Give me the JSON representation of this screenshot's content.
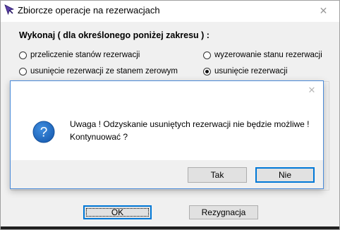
{
  "window": {
    "title": "Zbiorcze operacje na rezerwacjach",
    "close_glyph": "✕",
    "app_icon": "purple-cursor-icon"
  },
  "main": {
    "heading": "Wykonaj ( dla określonego poniżej zakresu ) :",
    "options": [
      {
        "label": "przeliczenie stanów rezerwacji",
        "checked": false
      },
      {
        "label": "wyzerowanie stanu rezerwacji",
        "checked": false
      },
      {
        "label": "usunięcie rezerwacji ze stanem zerowym",
        "checked": false
      },
      {
        "label": "usunięcie rezerwacji",
        "checked": true
      }
    ],
    "ok_label": "OK",
    "cancel_label": "Rezygnacja"
  },
  "dialog": {
    "close_glyph": "✕",
    "icon": "question-icon",
    "message_line1": "Uwaga ! Odzyskanie usuniętych rezerwacji nie będzie możliwe !",
    "message_line2": "Kontynuować ?",
    "yes_label": "Tak",
    "no_label": "Nie"
  },
  "colors": {
    "accent": "#0078d7",
    "question_icon": "#1a5fb4"
  }
}
